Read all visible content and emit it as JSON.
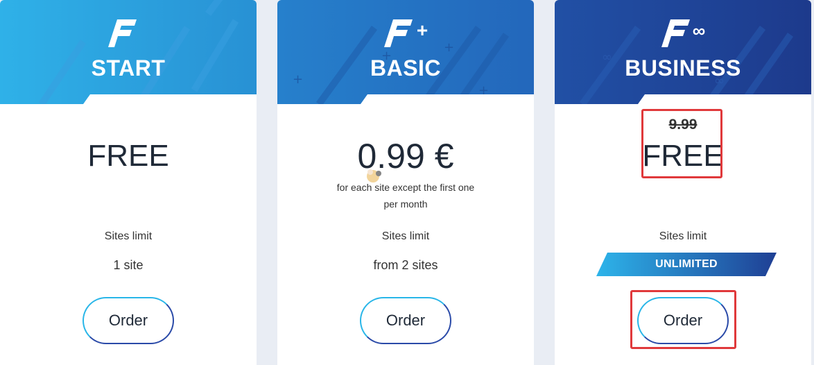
{
  "plans": [
    {
      "name": "START",
      "logo_suffix": "",
      "price": "FREE",
      "old_price": "",
      "price_note_line1": "",
      "price_note_line2": "",
      "sites_label": "Sites limit",
      "sites_value": "1 site",
      "order_label": "Order"
    },
    {
      "name": "BASIC",
      "logo_suffix": "+",
      "price": "0.99 €",
      "old_price": "",
      "price_note_line1": "for each site except the first one",
      "price_note_line2": "per month",
      "sites_label": "Sites limit",
      "sites_value": "from 2 sites",
      "order_label": "Order"
    },
    {
      "name": "BUSINESS",
      "logo_suffix": "∞",
      "price": "FREE",
      "old_price": "9.99",
      "price_note_line1": "",
      "price_note_line2": "",
      "sites_label": "Sites limit",
      "sites_value": "UNLIMITED",
      "order_label": "Order"
    }
  ],
  "icons": [
    "plan-logo-f-icon",
    "plus-icon",
    "infinity-icon"
  ],
  "colors": {
    "page_bg": "#e9edf4",
    "start_header": "#2aa9e0",
    "basic_header": "#2373c2",
    "business_header": "#1e3f92",
    "highlight": "#e0393b",
    "text": "#1f2937"
  }
}
